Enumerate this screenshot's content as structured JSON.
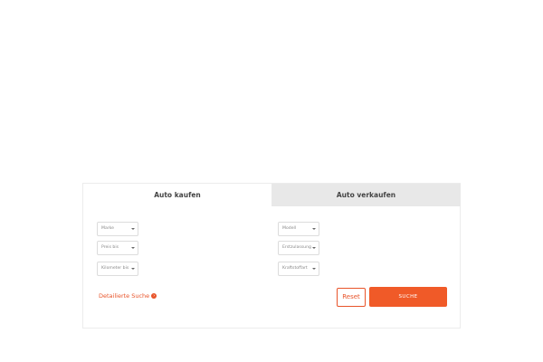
{
  "tabs": {
    "buy": "Auto kaufen",
    "sell": "Auto verkaufen"
  },
  "filters": {
    "left": [
      "Marke",
      "Preis bis",
      "Kilometer bis"
    ],
    "right": [
      "Modell",
      "Erstzulassung",
      "Kraftstoffart"
    ]
  },
  "detail_link": {
    "label": "Detailierte Suche",
    "icon": "arrow-circle-right-icon"
  },
  "buttons": {
    "reset": "Reset",
    "search": "SUCHE"
  },
  "colors": {
    "accent": "#f05a28",
    "inactive_tab": "#e8e8e8"
  }
}
